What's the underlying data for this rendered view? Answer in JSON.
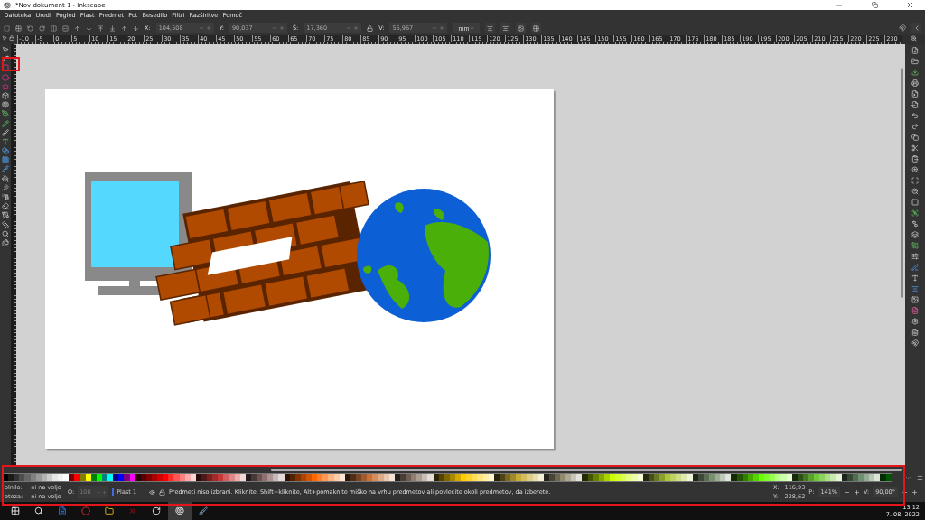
{
  "window": {
    "title": "*Nov dokument 1 - Inkscape"
  },
  "menu": [
    "Datoteka",
    "Uredi",
    "Pogled",
    "Plast",
    "Predmet",
    "Pot",
    "Besedilo",
    "Filtri",
    "Razširitve",
    "Pomoč"
  ],
  "toolbar": {
    "fields": [
      {
        "label": "X:",
        "value": "104,508"
      },
      {
        "label": "Y:",
        "value": "90,037"
      },
      {
        "label": "Š:",
        "value": "17,360"
      },
      {
        "label": "V:",
        "value": "56,967"
      }
    ],
    "unit": "mm"
  },
  "ruler": {
    "labels": [
      "-10",
      "-5",
      "0",
      "5",
      "10",
      "15",
      "20",
      "25",
      "30",
      "35",
      "40",
      "45",
      "50",
      "55",
      "60",
      "65",
      "70",
      "75",
      "80",
      "85",
      "90",
      "95",
      "100",
      "105",
      "110",
      "115",
      "120",
      "125",
      "130",
      "135",
      "140",
      "145",
      "150",
      "155",
      "160",
      "165",
      "170",
      "175",
      "180",
      "185",
      "190",
      "195",
      "200",
      "205",
      "210",
      "215",
      "220",
      "225",
      "230"
    ]
  },
  "palette": [
    {
      "color": "#000000"
    },
    {
      "color": "#1a1a1a"
    },
    {
      "color": "#333333"
    },
    {
      "color": "#4d4d4d"
    },
    {
      "color": "#666666"
    },
    {
      "color": "#808080"
    },
    {
      "color": "#999999"
    },
    {
      "color": "#b3b3b3"
    },
    {
      "color": "#cccccc"
    },
    {
      "color": "#e6e6e6"
    },
    {
      "color": "#f2f2f2"
    },
    {
      "color": "#ffffff"
    },
    {
      "color": "#800000"
    },
    {
      "color": "#ff0000"
    },
    {
      "color": "#808000"
    },
    {
      "color": "#ffff00"
    },
    {
      "color": "#008000"
    },
    {
      "color": "#00ff00"
    },
    {
      "color": "#008080"
    },
    {
      "color": "#00ffff"
    },
    {
      "color": "#000080"
    },
    {
      "color": "#0000ff"
    },
    {
      "color": "#800080"
    },
    {
      "color": "#ff00ff"
    },
    {
      "color": "#2b0000"
    },
    {
      "color": "#550000"
    },
    {
      "color": "#800000"
    },
    {
      "color": "#aa0000"
    },
    {
      "color": "#d40000"
    },
    {
      "color": "#ff0000"
    },
    {
      "color": "#ff2a2a"
    },
    {
      "color": "#ff5555"
    },
    {
      "color": "#ff8080"
    },
    {
      "color": "#ffaaaa"
    },
    {
      "color": "#ffd5d5"
    },
    {
      "color": "#280b0b"
    },
    {
      "color": "#501616"
    },
    {
      "color": "#782121"
    },
    {
      "color": "#a02c2c"
    },
    {
      "color": "#c83737"
    },
    {
      "color": "#d35f5f"
    },
    {
      "color": "#de8787"
    },
    {
      "color": "#e9afaf"
    },
    {
      "color": "#f4d7d7"
    },
    {
      "color": "#241c1c"
    },
    {
      "color": "#483737"
    },
    {
      "color": "#6c5353"
    },
    {
      "color": "#916f6f"
    },
    {
      "color": "#ac9393"
    },
    {
      "color": "#c8b7b7"
    },
    {
      "color": "#e3dbdb"
    },
    {
      "color": "#2b1100"
    },
    {
      "color": "#552200"
    },
    {
      "color": "#803300"
    },
    {
      "color": "#aa4400"
    },
    {
      "color": "#d45500"
    },
    {
      "color": "#ff6600"
    },
    {
      "color": "#ff7f2a"
    },
    {
      "color": "#ff9955"
    },
    {
      "color": "#ffb380"
    },
    {
      "color": "#ffccaa"
    },
    {
      "color": "#ffe6d5"
    },
    {
      "color": "#28170b"
    },
    {
      "color": "#502d16"
    },
    {
      "color": "#784421"
    },
    {
      "color": "#a05a2c"
    },
    {
      "color": "#c87137"
    },
    {
      "color": "#d38d5f"
    },
    {
      "color": "#deaa87"
    },
    {
      "color": "#e9c6af"
    },
    {
      "color": "#f4e3d7"
    },
    {
      "color": "#241f1c"
    },
    {
      "color": "#483e37"
    },
    {
      "color": "#6c5d53"
    },
    {
      "color": "#917c6f"
    },
    {
      "color": "#ac9d93"
    },
    {
      "color": "#c8beb7"
    },
    {
      "color": "#e3dedb"
    },
    {
      "color": "#2b2200"
    },
    {
      "color": "#554400"
    },
    {
      "color": "#806600"
    },
    {
      "color": "#aa8800"
    },
    {
      "color": "#d4aa00"
    },
    {
      "color": "#ffcc00"
    },
    {
      "color": "#ffd42a"
    },
    {
      "color": "#ffdd55"
    },
    {
      "color": "#ffe680"
    },
    {
      "color": "#ffeeaa"
    },
    {
      "color": "#fff6d5"
    },
    {
      "color": "#28220b"
    },
    {
      "color": "#504416"
    },
    {
      "color": "#786721"
    },
    {
      "color": "#a0892c"
    },
    {
      "color": "#c8ab37"
    },
    {
      "color": "#d3bc5f"
    },
    {
      "color": "#decd87"
    },
    {
      "color": "#e9ddaf"
    },
    {
      "color": "#f4eed7"
    },
    {
      "color": "#24221c"
    },
    {
      "color": "#484537"
    },
    {
      "color": "#6c6753"
    },
    {
      "color": "#918a6f"
    },
    {
      "color": "#aca793"
    },
    {
      "color": "#c8c4b7"
    },
    {
      "color": "#e3e2db"
    },
    {
      "color": "#222b00"
    },
    {
      "color": "#445500"
    },
    {
      "color": "#668000"
    },
    {
      "color": "#88aa00"
    },
    {
      "color": "#aad400"
    },
    {
      "color": "#ccff00"
    },
    {
      "color": "#d4ff2a"
    },
    {
      "color": "#ddff55"
    },
    {
      "color": "#e5ff80"
    },
    {
      "color": "#eeffaa"
    },
    {
      "color": "#f6ffd5"
    },
    {
      "color": "#22280b"
    },
    {
      "color": "#445016"
    },
    {
      "color": "#677821"
    },
    {
      "color": "#89a02c"
    },
    {
      "color": "#abc837"
    },
    {
      "color": "#bcd35f"
    },
    {
      "color": "#cdde87"
    },
    {
      "color": "#dde9af"
    },
    {
      "color": "#eef4d7"
    },
    {
      "color": "#1f241c"
    },
    {
      "color": "#3e4837"
    },
    {
      "color": "#5a6c53"
    },
    {
      "color": "#7a916f"
    },
    {
      "color": "#9dac93"
    },
    {
      "color": "#bec8b7"
    },
    {
      "color": "#dee3db"
    },
    {
      "color": "#112b00"
    },
    {
      "color": "#225500"
    },
    {
      "color": "#338000"
    },
    {
      "color": "#44aa00"
    },
    {
      "color": "#55d400"
    },
    {
      "color": "#66ff00"
    },
    {
      "color": "#7fff2a"
    },
    {
      "color": "#99ff55"
    },
    {
      "color": "#b3ff80"
    },
    {
      "color": "#ccffaa"
    },
    {
      "color": "#e5ffd5"
    },
    {
      "color": "#17280b"
    },
    {
      "color": "#2d5016"
    },
    {
      "color": "#447821"
    },
    {
      "color": "#5aa02c"
    },
    {
      "color": "#71c837"
    },
    {
      "color": "#8dd35f"
    },
    {
      "color": "#aade87"
    },
    {
      "color": "#c6e9af"
    },
    {
      "color": "#e3f4d7"
    },
    {
      "color": "#1c241c"
    },
    {
      "color": "#374837"
    },
    {
      "color": "#536c53"
    },
    {
      "color": "#6f916f"
    },
    {
      "color": "#93ac93"
    },
    {
      "color": "#b7c8b7"
    },
    {
      "color": "#dbe3db"
    },
    {
      "color": "#002b00"
    },
    {
      "color": "#005500"
    }
  ],
  "status": {
    "fill_label": "olnilo:",
    "fill_value": "ni na voljo",
    "stroke_label": "oteza:",
    "stroke_value": "ni na voljo",
    "opacity_label": "O:",
    "opacity_value": "100",
    "layer": "Plast 1",
    "message": "Predmeti niso izbrani. Kliknite, Shift+kliknite, Alt+pomaknite miško na vrhu predmetov ali povlecite okoli predmetov, da izberete.",
    "x_label": "X:",
    "x_value": "116,93",
    "y_label": "Y:",
    "y_value": "228,62",
    "zoom_label": "P:",
    "zoom_value": "141%",
    "rotate_label": "V:",
    "rotate_value": "90,00°"
  },
  "taskbar": {
    "time": "13:12",
    "date": "7. 08. 2022"
  }
}
